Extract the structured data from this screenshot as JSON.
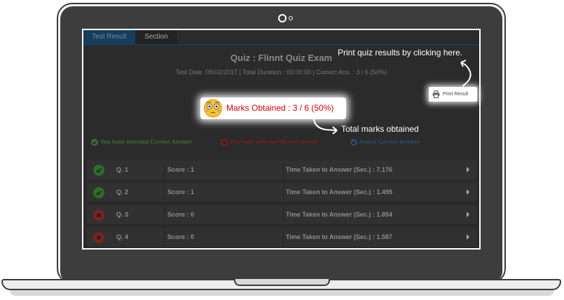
{
  "tabs": {
    "active": "Test Result",
    "second": "Section"
  },
  "quiz": {
    "title": "Quiz : Flinnt Quiz Exam",
    "meta": "Test Date :09/02/2017 | Total Duration : 00:00:00 | Correct Ans. : 3 / 6 (50%)"
  },
  "print": {
    "label": "Print Result",
    "icon": "printer-icon"
  },
  "marks": {
    "text": "Marks Obtained : 3 / 6 (50%)",
    "icon": "flushed-face-emoji"
  },
  "legend": {
    "correct": "You have selected Correct Answer",
    "wrong": "You have selected Wrong answer",
    "actual": "Actual Correct Answer"
  },
  "rows": [
    {
      "q": "Q. 1",
      "score": "Score : 1",
      "time": "Time Taken to Answer (Sec.) : 7.176",
      "status": "correct"
    },
    {
      "q": "Q. 2",
      "score": "Score : 1",
      "time": "Time Taken to Answer (Sec.) : 1.495",
      "status": "correct"
    },
    {
      "q": "Q. 3",
      "score": "Score : 0",
      "time": "Time Taken to Answer (Sec.) : 1.854",
      "status": "wrong"
    },
    {
      "q": "Q. 4",
      "score": "Score : 0",
      "time": "Time Taken to Answer (Sec.) : 1.587",
      "status": "wrong"
    }
  ],
  "callouts": {
    "print": "Print quiz results by clicking here.",
    "marks": "Total marks obtained"
  },
  "colors": {
    "correct": "#2f6b2a",
    "wrong": "#7a2222",
    "actual": "#2a4a74",
    "marks_text": "#d40000"
  }
}
